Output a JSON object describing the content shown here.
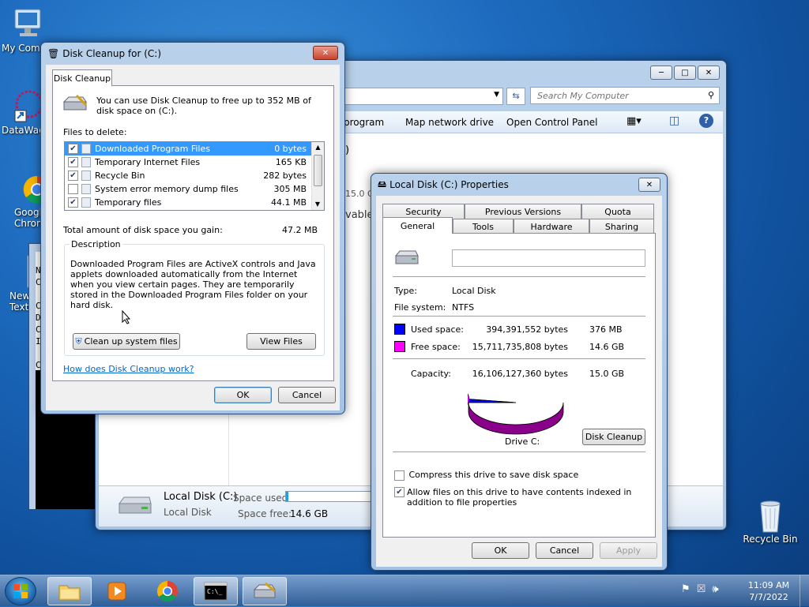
{
  "desktop": {
    "icons": [
      {
        "label": "My Comp"
      },
      {
        "label": "DataWag"
      },
      {
        "label": "Googl\nChrom"
      },
      {
        "label": "New\nText"
      },
      {
        "label": "Recycle Bin"
      }
    ]
  },
  "explorer": {
    "search_placeholder": "Search My Computer",
    "toolbar": [
      "program",
      "Map network drive",
      "Open Control Panel"
    ],
    "partial_text_1": "15.0 G",
    "partial_text_2": "vable",
    "partial_text_3": ")",
    "details": {
      "drive_name": "Local Disk (C:)",
      "space_used_label": "Space used:",
      "drive_type": "Local Disk",
      "space_free_label": "Space free:",
      "space_free_value": "14.6 GB"
    }
  },
  "cmd_window": {
    "visible_chars": [
      "N",
      "C",
      "C",
      "D",
      "C",
      "I",
      "C"
    ]
  },
  "disk_cleanup": {
    "title": "Disk Cleanup for  (C:)",
    "tab": "Disk Cleanup",
    "intro": "You can use Disk Cleanup to free up to 352 MB of disk space on  (C:).",
    "files_to_delete_label": "Files to delete:",
    "files": [
      {
        "checked": true,
        "name": "Downloaded Program Files",
        "size": "0 bytes",
        "selected": true
      },
      {
        "checked": true,
        "name": "Temporary Internet Files",
        "size": "165 KB",
        "selected": false
      },
      {
        "checked": true,
        "name": "Recycle Bin",
        "size": "282 bytes",
        "selected": false
      },
      {
        "checked": false,
        "name": "System error memory dump files",
        "size": "305 MB",
        "selected": false
      },
      {
        "checked": true,
        "name": "Temporary files",
        "size": "44.1 MB",
        "selected": false
      }
    ],
    "total_label": "Total amount of disk space you gain:",
    "total_value": "47.2 MB",
    "description_label": "Description",
    "description_text": "Downloaded Program Files are ActiveX controls and Java applets downloaded automatically from the Internet when you view certain pages. They are temporarily stored in the Downloaded Program Files folder on your hard disk.",
    "cleanup_system_button": "Clean up system files",
    "view_files_button": "View Files",
    "help_link": "How does Disk Cleanup work?",
    "ok_button": "OK",
    "cancel_button": "Cancel"
  },
  "properties": {
    "title": "Local Disk (C:) Properties",
    "tabs_row1": [
      "Security",
      "Previous Versions",
      "Quota"
    ],
    "tabs_row2": [
      "General",
      "Tools",
      "Hardware",
      "Sharing"
    ],
    "volume_label_value": "",
    "type_label": "Type:",
    "type_value": "Local Disk",
    "fs_label": "File system:",
    "fs_value": "NTFS",
    "used_label": "Used space:",
    "used_bytes": "394,391,552 bytes",
    "used_short": "376 MB",
    "free_label": "Free space:",
    "free_bytes": "15,711,735,808 bytes",
    "free_short": "14.6 GB",
    "capacity_label": "Capacity:",
    "capacity_bytes": "16,106,127,360 bytes",
    "capacity_short": "15.0 GB",
    "used_color": "#0000ff",
    "free_color": "#ff00ff",
    "used_fraction": 0.0245,
    "drive_label": "Drive C:",
    "disk_cleanup_button": "Disk Cleanup",
    "compress_label": "Compress this drive to save disk space",
    "compress_checked": false,
    "index_label": "Allow files on this drive to have contents indexed in addition to file properties",
    "index_checked": true,
    "ok_button": "OK",
    "cancel_button": "Cancel",
    "apply_button": "Apply"
  },
  "taskbar": {
    "time": "11:09 AM",
    "date": "7/7/2022"
  }
}
